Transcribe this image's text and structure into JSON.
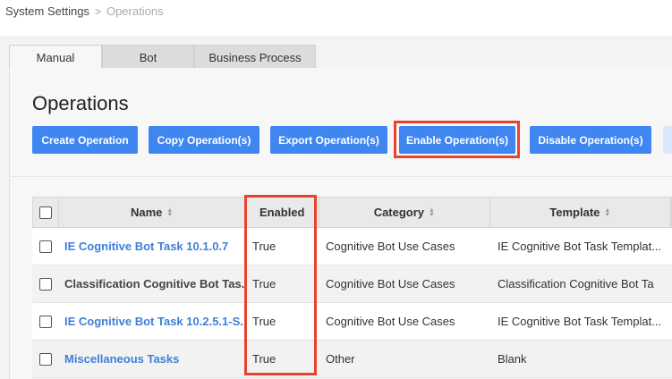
{
  "breadcrumb": {
    "root": "System Settings",
    "separator": ">",
    "current": "Operations"
  },
  "tabs": [
    {
      "label": "Manual"
    },
    {
      "label": "Bot"
    },
    {
      "label": "Business Process"
    }
  ],
  "page": {
    "title": "Operations"
  },
  "toolbar": {
    "create": "Create Operation",
    "copy": "Copy Operation(s)",
    "export": "Export Operation(s)",
    "enable": "Enable Operation(s)",
    "disable": "Disable Operation(s)"
  },
  "table": {
    "headers": {
      "name": "Name",
      "enabled": "Enabled",
      "category": "Category",
      "template": "Template"
    },
    "rows": [
      {
        "name": "IE Cognitive Bot Task 10.1.0.7",
        "enabled": "True",
        "category": "Cognitive Bot Use Cases",
        "template": "IE Cognitive Bot Task Templat..."
      },
      {
        "name": "Classification Cognitive Bot Tas...",
        "enabled": "True",
        "category": "Cognitive Bot Use Cases",
        "template": "Classification Cognitive Bot Ta"
      },
      {
        "name": "IE Cognitive Bot Task 10.2.5.1-S...",
        "enabled": "True",
        "category": "Cognitive Bot Use Cases",
        "template": "IE Cognitive Bot Task Templat..."
      },
      {
        "name": "Miscellaneous Tasks",
        "enabled": "True",
        "category": "Other",
        "template": "Blank"
      }
    ]
  },
  "colors": {
    "accent": "#3f86f0",
    "highlight": "#e8432e",
    "link": "#3f7fd9"
  }
}
